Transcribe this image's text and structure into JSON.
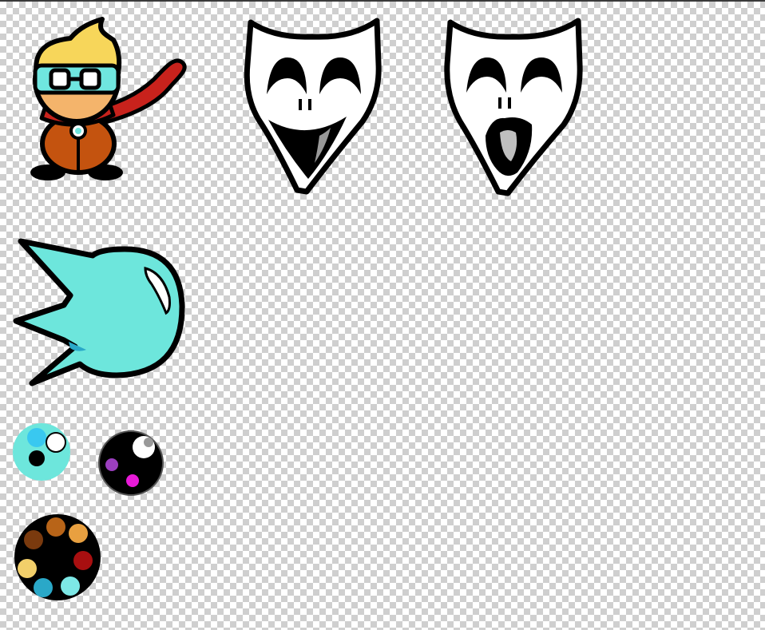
{
  "canvas": {
    "background": "transparent-checkerboard",
    "checker_colors": [
      "#ffffff",
      "#cfcfcf"
    ]
  },
  "sprites": [
    {
      "name": "hero-character",
      "colors": {
        "hair": "#f7d65a",
        "goggles": "#6fe6df",
        "skin": "#f4b46b",
        "scarf": "#c8221c",
        "body": "#c4530f",
        "outline": "#000000"
      }
    },
    {
      "name": "mask-smiling",
      "colors": {
        "fill": "#ffffff",
        "outline": "#000000"
      }
    },
    {
      "name": "mask-screaming",
      "colors": {
        "fill": "#ffffff",
        "outline": "#000000"
      }
    },
    {
      "name": "spiky-cyan-projectile",
      "colors": {
        "fill": "#6de6dc",
        "outline": "#000000",
        "shine": "#ffffff"
      }
    },
    {
      "name": "cyan-orb",
      "colors": {
        "fill": "#6de6dc",
        "accent": "#39c8f0",
        "pupil": "#000000",
        "shine": "#ffffff"
      }
    },
    {
      "name": "black-orb",
      "colors": {
        "fill": "#000000",
        "shine": "#ffffff",
        "dot-purple": "#9b3fbf",
        "dot-magenta": "#e81ad8"
      }
    },
    {
      "name": "color-palette-orb",
      "colors": {
        "fill": "#000000",
        "dots": [
          "#7a3a0e",
          "#b86418",
          "#e8a040",
          "#a80f10",
          "#7de8e6",
          "#2aa8c8",
          "#f2cf6a"
        ]
      }
    }
  ]
}
